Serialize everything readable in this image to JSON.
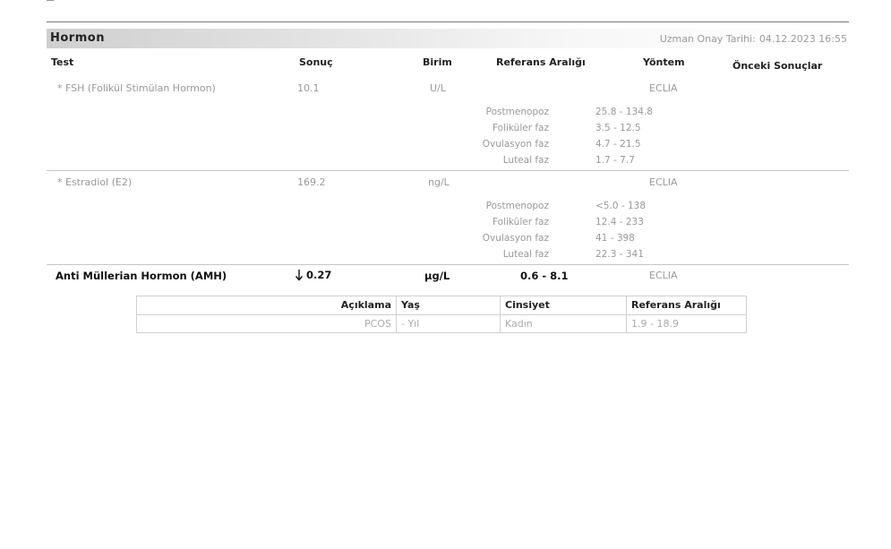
{
  "section": {
    "title": "Hormon",
    "approval_label": "Uzman Onay Tarihi:",
    "approval_date": "04.12.2023 16:55"
  },
  "columns": {
    "test": "Test",
    "result": "Sonuç",
    "unit": "Birim",
    "reference": "Referans Aralığı",
    "method": "Yöntem",
    "previous": "Önceki Sonuçlar"
  },
  "tests": [
    {
      "name": "* FSH (Folikül Stimülan Hormon)",
      "result": "10.1",
      "unit": "U/L",
      "method": "ECLIA",
      "references": [
        {
          "label": "Postmenopoz",
          "value": "25.8 - 134.8"
        },
        {
          "label": "Foliküler faz",
          "value": "3.5 - 12.5"
        },
        {
          "label": "Ovulasyon faz",
          "value": "4.7 - 21.5"
        },
        {
          "label": "Luteal faz",
          "value": "1.7 - 7.7"
        }
      ]
    },
    {
      "name": "* Estradiol (E2)",
      "result": "169.2",
      "unit": "ng/L",
      "method": "ECLIA",
      "references": [
        {
          "label": "Postmenopoz",
          "value": "<5.0 - 138"
        },
        {
          "label": "Foliküler faz",
          "value": "12.4 - 233"
        },
        {
          "label": "Ovulasyon faz",
          "value": "41 - 398"
        },
        {
          "label": "Luteal faz",
          "value": "22.3 - 341"
        }
      ]
    },
    {
      "name": "Anti Müllerian Hormon (AMH)",
      "flag_icon": "arrow-down-icon",
      "result": "0.27",
      "unit": "µg/L",
      "reference": "0.6 - 8.1",
      "method": "ECLIA"
    }
  ],
  "amh_reference_table": {
    "headers": {
      "description": "Açıklama",
      "age": "Yaş",
      "gender": "Cinsiyet",
      "range": "Referans Aralığı"
    },
    "rows": [
      {
        "description": "PCOS",
        "age": " - Yıl",
        "gender": "Kadın",
        "range": "1.9 - 18.9"
      }
    ]
  }
}
